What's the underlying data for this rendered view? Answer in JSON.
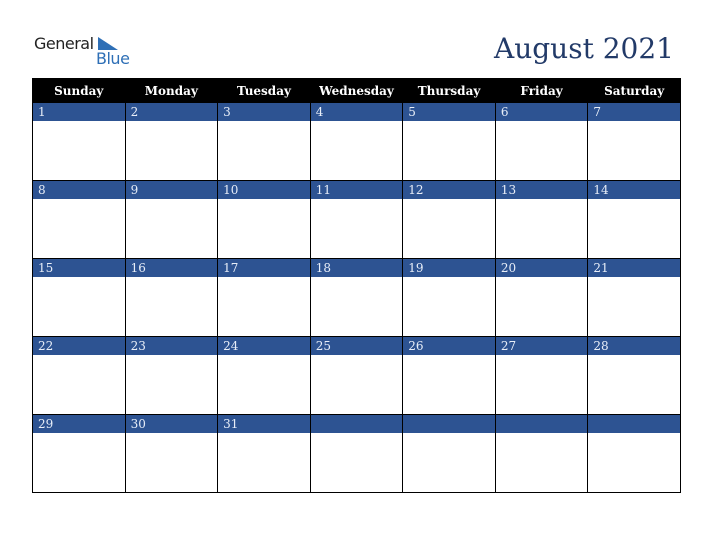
{
  "logo": {
    "line1": "General",
    "line2": "Blue"
  },
  "title": "August 2021",
  "weekdays": [
    "Sunday",
    "Monday",
    "Tuesday",
    "Wednesday",
    "Thursday",
    "Friday",
    "Saturday"
  ],
  "weeks": [
    [
      "1",
      "2",
      "3",
      "4",
      "5",
      "6",
      "7"
    ],
    [
      "8",
      "9",
      "10",
      "11",
      "12",
      "13",
      "14"
    ],
    [
      "15",
      "16",
      "17",
      "18",
      "19",
      "20",
      "21"
    ],
    [
      "22",
      "23",
      "24",
      "25",
      "26",
      "27",
      "28"
    ],
    [
      "29",
      "30",
      "31",
      "",
      "",
      "",
      ""
    ]
  ],
  "colors": {
    "header_bg": "#000000",
    "band_bg": "#2d5392",
    "title": "#223a68",
    "logo_blue": "#2e6fb6"
  }
}
